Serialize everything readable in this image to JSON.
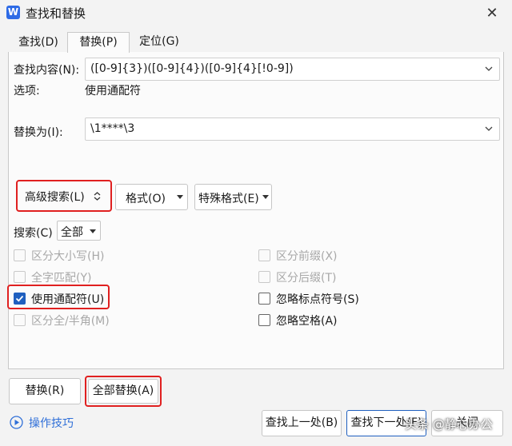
{
  "window": {
    "title": "查找和替换",
    "app_icon_letter": "W",
    "close_glyph": "✕"
  },
  "tabs": [
    {
      "label": "查找(D)"
    },
    {
      "label": "替换(P)"
    },
    {
      "label": "定位(G)"
    }
  ],
  "find": {
    "label": "查找内容(N):",
    "value": "([0-9]{3})([0-9]{4})([0-9]{4}[!0-9])",
    "options_label": "选项:",
    "options_value": "使用通配符"
  },
  "replace": {
    "label": "替换为(I):",
    "value": "\\1****\\3"
  },
  "toolbar": {
    "advanced_label": "高级搜索(L)",
    "format_label": "格式(O)",
    "special_label": "特殊格式(E)"
  },
  "search": {
    "label": "搜索(C)",
    "value": "全部"
  },
  "checkboxes_left": [
    {
      "label": "区分大小写(H)",
      "checked": false,
      "enabled": false
    },
    {
      "label": "全字匹配(Y)",
      "checked": false,
      "enabled": false
    },
    {
      "label": "使用通配符(U)",
      "checked": true,
      "enabled": true
    },
    {
      "label": "区分全/半角(M)",
      "checked": false,
      "enabled": false
    }
  ],
  "checkboxes_right": [
    {
      "label": "区分前缀(X)",
      "checked": false,
      "enabled": false
    },
    {
      "label": "区分后缀(T)",
      "checked": false,
      "enabled": false
    },
    {
      "label": "忽略标点符号(S)",
      "checked": false,
      "enabled": true
    },
    {
      "label": "忽略空格(A)",
      "checked": false,
      "enabled": true
    }
  ],
  "actions": {
    "replace_label": "替换(R)",
    "replace_all_label": "全部替换(A)",
    "tips_label": "操作技巧",
    "find_prev_label": "查找上一处(B)",
    "find_next_label": "查找下一处(F)",
    "close_label": "关闭"
  },
  "watermark": "头条 @静心办公",
  "colors": {
    "accent": "#1f5fbf",
    "highlight": "#e02020",
    "link": "#2f6fd8"
  }
}
